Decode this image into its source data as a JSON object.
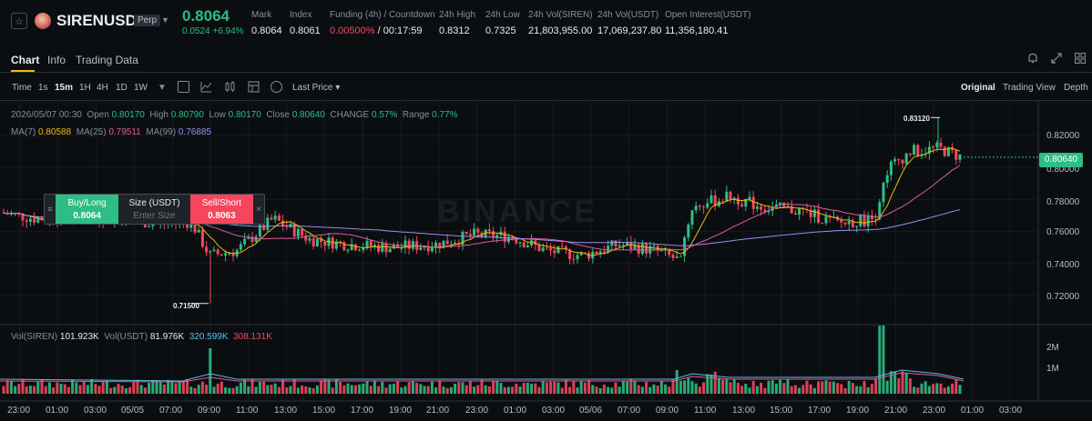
{
  "header": {
    "symbol": "SIRENUSDT",
    "badge": "Perp",
    "last_price": "0.8064",
    "change": "0.0524 +6.94%",
    "stats": [
      {
        "label": "Mark",
        "value": "0.8064"
      },
      {
        "label": "Index",
        "value": "0.8061"
      },
      {
        "label": "Funding (4h) / Countdown",
        "value_red": "0.00500%",
        "value": " / 00:17:59"
      },
      {
        "label": "24h High",
        "value": "0.8312"
      },
      {
        "label": "24h Low",
        "value": "0.7325"
      },
      {
        "label": "24h Vol(SIREN)",
        "value": "21,803,955.00"
      },
      {
        "label": "24h Vol(USDT)",
        "value": "17,069,237.80"
      },
      {
        "label": "Open Interest(USDT)",
        "value": "11,356,180.41"
      }
    ],
    "icons": [
      "star-icon",
      "siren-coin-icon",
      "chevron-down-icon"
    ]
  },
  "tabs": [
    "Chart",
    "Info",
    "Trading Data"
  ],
  "toolbar": {
    "intervals": [
      "Time",
      "1s",
      "15m",
      "1H",
      "4H",
      "1D",
      "1W"
    ],
    "price_type": "Last Price",
    "views": [
      "Original",
      "Trading View",
      "Depth"
    ]
  },
  "chart_info": {
    "datetime": "2026/05/07 00:30",
    "open_label": "Open",
    "open": "0.80170",
    "high_label": "High",
    "high": "0.80790",
    "low_label": "Low",
    "low": "0.80170",
    "close_label": "Close",
    "close": "0.80640",
    "change_label": "CHANGE",
    "change": "0.57%",
    "range_label": "Range",
    "range": "0.77%"
  },
  "ma": {
    "ma7_label": "MA(7)",
    "ma7": "0.80588",
    "ma25_label": "MA(25)",
    "ma25": "0.79511",
    "ma99_label": "MA(99)",
    "ma99": "0.76885"
  },
  "volume": {
    "siren_label": "Vol(SIREN)",
    "siren": "101.923K",
    "usdt_label": "Vol(USDT)",
    "usdt": "81.976K",
    "v1": "320.599K",
    "v2": "308.131K"
  },
  "order_panel": {
    "buy_label": "Buy/Long",
    "buy_price": "0.8064",
    "size_label": "Size (USDT)",
    "size_placeholder": "Enter Size",
    "sell_label": "Sell/Short",
    "sell_price": "0.8063"
  },
  "price_axis": [
    "0.82000",
    "0.80000",
    "0.78000",
    "0.76000",
    "0.74000",
    "0.72000"
  ],
  "current_price_tag": "0.80640",
  "high_marker": "0.83120",
  "low_marker": "0.71500",
  "volume_axis": [
    "2M",
    "1M"
  ],
  "time_axis": [
    "23:00",
    "01:00",
    "03:00",
    "05/05",
    "07:00",
    "09:00",
    "11:00",
    "13:00",
    "15:00",
    "17:00",
    "19:00",
    "21:00",
    "23:00",
    "01:00",
    "03:00",
    "05/06",
    "07:00",
    "09:00",
    "11:00",
    "13:00",
    "15:00",
    "17:00",
    "19:00",
    "21:00",
    "23:00",
    "01:00",
    "03:00"
  ],
  "watermark": "BINANCE",
  "colors": {
    "up": "#2ebd85",
    "down": "#f6465d",
    "ma7": "#f0b90b",
    "ma25": "#e05aa0",
    "ma99": "#9b8cf0",
    "accent": "#f0b90b"
  }
}
